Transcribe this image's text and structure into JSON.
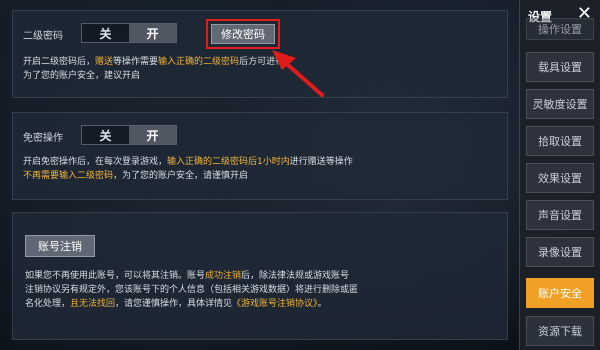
{
  "panel1": {
    "label": "二级密码",
    "toggle_off": "关",
    "toggle_on": "开",
    "change_button": "修改密码",
    "desc_line1_a": "开启二级密码后，",
    "desc_line1_hl1": "赠送",
    "desc_line1_b": "等操作需要",
    "desc_line1_hl2": "输入正确的二级密码",
    "desc_line1_c": "后方可进行",
    "desc_line2": "为了您的账户安全，建议开启"
  },
  "panel2": {
    "label": "免密操作",
    "toggle_off": "关",
    "toggle_on": "开",
    "desc_line1_a": "开启免密操作后，在每次登录游戏，",
    "desc_line1_hl": "输入正确的二级密码后1小时内",
    "desc_line1_b": "进行赠送等操作",
    "desc_line2_hl": "不再需要输入二级密码",
    "desc_line2_b": "，为了您的账户安全，请谨慎开启"
  },
  "panel3": {
    "button": "账号注销",
    "line1_a": "如果您不再使用此账号，可以将其注销。账号",
    "line1_hl": "成功注销",
    "line1_b": "后，除法律法规或游戏账号",
    "line2": "注销协议另有规定外，您该账号下的个人信息（包括相关游戏数据）将进行删除或匿",
    "line3_a": "名化处理，",
    "line3_hl1": "且无法找回",
    "line3_b": "，请您谨慎操作，具体详情见",
    "line3_hl2": "《游戏账号注销协议》",
    "line3_c": "。"
  },
  "sidebar": {
    "title": "设置",
    "close": "✕",
    "items": [
      {
        "label": "操作设置",
        "active": false
      },
      {
        "label": "载具设置",
        "active": false
      },
      {
        "label": "灵敏度设置",
        "active": false
      },
      {
        "label": "拾取设置",
        "active": false
      },
      {
        "label": "效果设置",
        "active": false
      },
      {
        "label": "声音设置",
        "active": false
      },
      {
        "label": "录像设置",
        "active": false
      },
      {
        "label": "账户安全",
        "active": true
      },
      {
        "label": "资源下载",
        "active": false
      }
    ]
  },
  "colors": {
    "accent": "#f0a125",
    "highlight_text": "#f2b33a",
    "annotation_red": "#e21b1b"
  },
  "icons": {
    "close": "close-icon",
    "arrow": "red-arrow-annotation"
  }
}
